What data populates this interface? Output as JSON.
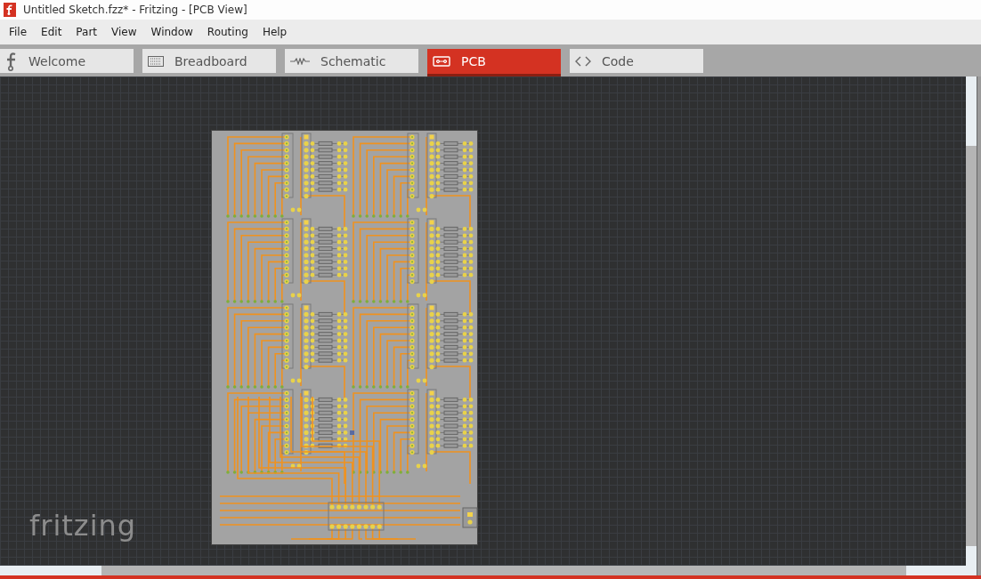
{
  "window": {
    "title": "Untitled Sketch.fzz* - Fritzing - [PCB View]"
  },
  "menu": [
    "File",
    "Edit",
    "Part",
    "View",
    "Window",
    "Routing",
    "Help"
  ],
  "tabs": [
    {
      "label": "Welcome",
      "selected": false
    },
    {
      "label": "Breadboard",
      "selected": false
    },
    {
      "label": "Schematic",
      "selected": false
    },
    {
      "label": "PCB",
      "selected": true
    },
    {
      "label": "Code",
      "selected": false
    }
  ],
  "canvas": {
    "logo": "fritzing"
  }
}
